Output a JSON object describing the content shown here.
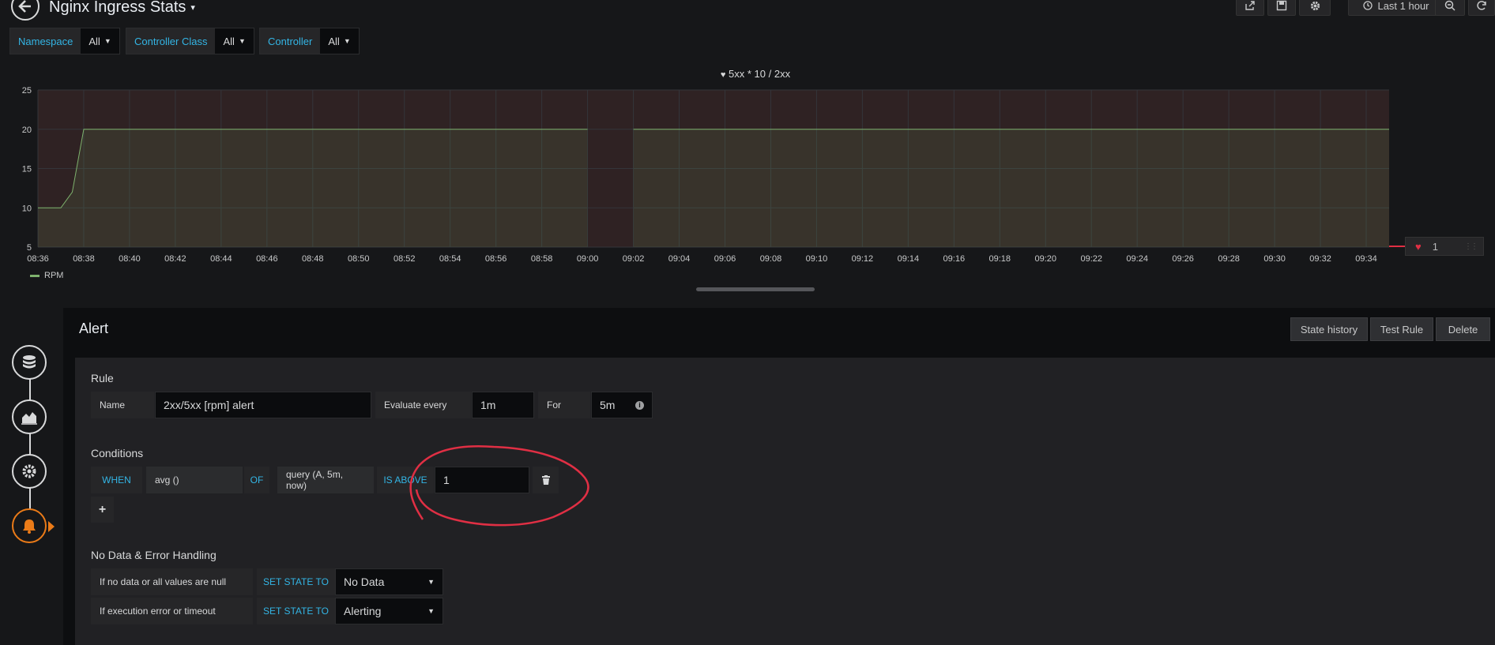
{
  "header": {
    "title": "Nginx Ingress Stats",
    "time_range": "Last 1 hour"
  },
  "variables": [
    {
      "label": "Namespace",
      "value": "All"
    },
    {
      "label": "Controller Class",
      "value": "All"
    },
    {
      "label": "Controller",
      "value": "All"
    }
  ],
  "chart_data": {
    "type": "line",
    "title": "5xx * 10 / 2xx",
    "x": [
      "08:36",
      "08:37",
      "08:37:30",
      "08:38",
      "08:40",
      "08:42",
      "08:44",
      "08:46",
      "08:48",
      "08:50",
      "08:52",
      "08:54",
      "08:56",
      "08:58",
      "09:00",
      "09:01",
      "09:01:30",
      "09:02",
      "09:04",
      "09:06",
      "09:08",
      "09:10",
      "09:12",
      "09:14",
      "09:16",
      "09:18",
      "09:20",
      "09:22",
      "09:24",
      "09:26",
      "09:28",
      "09:30",
      "09:32",
      "09:34",
      "09:35"
    ],
    "x_ticks": [
      "08:36",
      "08:38",
      "08:40",
      "08:42",
      "08:44",
      "08:46",
      "08:48",
      "08:50",
      "08:52",
      "08:54",
      "08:56",
      "08:58",
      "09:00",
      "09:02",
      "09:04",
      "09:06",
      "09:08",
      "09:10",
      "09:12",
      "09:14",
      "09:16",
      "09:18",
      "09:20",
      "09:22",
      "09:24",
      "09:26",
      "09:28",
      "09:30",
      "09:32",
      "09:34"
    ],
    "y_ticks": [
      5,
      10,
      15,
      20,
      25
    ],
    "ylim": [
      5,
      25
    ],
    "series": [
      {
        "name": "RPM",
        "color": "#7eb26d",
        "values": [
          10,
          10,
          12,
          20,
          20,
          20,
          20,
          20,
          20,
          20,
          20,
          20,
          20,
          20,
          20,
          null,
          null,
          20,
          20,
          20,
          20,
          20,
          20,
          20,
          20,
          20,
          20,
          20,
          20,
          20,
          20,
          20,
          20,
          20,
          20
        ]
      }
    ],
    "threshold": 1,
    "threshold_color": "#e02f44",
    "legend_position": "bottom-left",
    "grid": true
  },
  "threshold_badge": {
    "value": "1"
  },
  "alert": {
    "title": "Alert",
    "buttons": {
      "state_history": "State history",
      "test_rule": "Test Rule",
      "delete": "Delete"
    },
    "rule": {
      "section": "Rule",
      "name_label": "Name",
      "name_value": "2xx/5xx [rpm] alert",
      "evaluate_label": "Evaluate every",
      "evaluate_value": "1m",
      "for_label": "For",
      "for_value": "5m"
    },
    "conditions": {
      "section": "Conditions",
      "when": "WHEN",
      "reducer": "avg ()",
      "of": "OF",
      "query": "query (A, 5m, now)",
      "evaluator": "IS ABOVE",
      "threshold": "1",
      "add": "+"
    },
    "nodata": {
      "section": "No Data & Error Handling",
      "rows": [
        {
          "label": "If no data or all values are null",
          "action": "SET STATE TO",
          "value": "No Data"
        },
        {
          "label": "If execution error or timeout",
          "action": "SET STATE TO",
          "value": "Alerting"
        }
      ]
    }
  },
  "colors": {
    "accent": "#33b5e5",
    "active_step": "#eb7b18",
    "annotation": "#e02f44"
  }
}
